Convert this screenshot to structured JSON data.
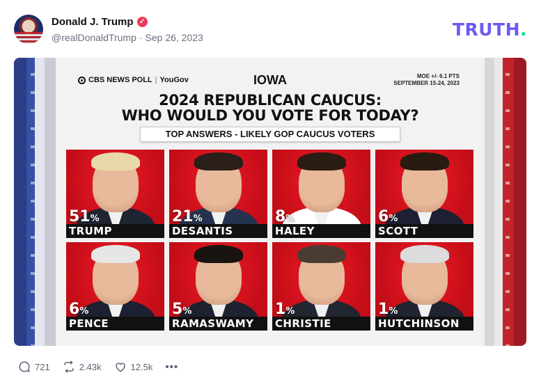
{
  "post": {
    "author_name": "Donald J. Trump",
    "verified_mark": "✓",
    "handle": "@realDonaldTrump",
    "separator": "·",
    "date": "Sep 26, 2023"
  },
  "brand": {
    "text": "TRUTH",
    "dot": ".",
    "color": "#6d5bf2",
    "dot_color": "#18d3c4"
  },
  "graphic": {
    "source_left": "CBS NEWS POLL",
    "source_sep": "|",
    "source_right": "YouGov",
    "state": "IOWA",
    "moe": "MOE +/- 6.1 PTS",
    "dates": "SEPTEMBER 15-24, 2023",
    "title_line1": "2024 REPUBLICAN CAUCUS:",
    "title_line2": "WHO WOULD YOU VOTE FOR TODAY?",
    "subtitle": "TOP ANSWERS - LIKELY GOP CAUCUS VOTERS",
    "card_color": "#d8101b",
    "candidates": [
      {
        "pct": "51",
        "unit": "%",
        "name": "TRUMP",
        "hair": "#e9d9a8",
        "suit": "#1f2431"
      },
      {
        "pct": "21",
        "unit": "%",
        "name": "DESANTIS",
        "hair": "#2a1f1a",
        "suit": "#26334f"
      },
      {
        "pct": "8",
        "unit": "%",
        "name": "HALEY",
        "hair": "#2b1c14",
        "suit": "#ffffff"
      },
      {
        "pct": "6",
        "unit": "%",
        "name": "SCOTT",
        "hair": "#2a1b12",
        "suit": "#1c2030"
      },
      {
        "pct": "6",
        "unit": "%",
        "name": "PENCE",
        "hair": "#e6e6e6",
        "suit": "#1c2030"
      },
      {
        "pct": "5",
        "unit": "%",
        "name": "RAMASWAMY",
        "hair": "#1a1410",
        "suit": "#1e2230"
      },
      {
        "pct": "1",
        "unit": "%",
        "name": "CHRISTIE",
        "hair": "#4a3c33",
        "suit": "#222631"
      },
      {
        "pct": "1",
        "unit": "%",
        "name": "HUTCHINSON",
        "hair": "#dcdcdc",
        "suit": "#202431"
      }
    ]
  },
  "actions": {
    "replies": "721",
    "retruths": "2.43k",
    "likes": "12.5k",
    "more": "•••"
  }
}
